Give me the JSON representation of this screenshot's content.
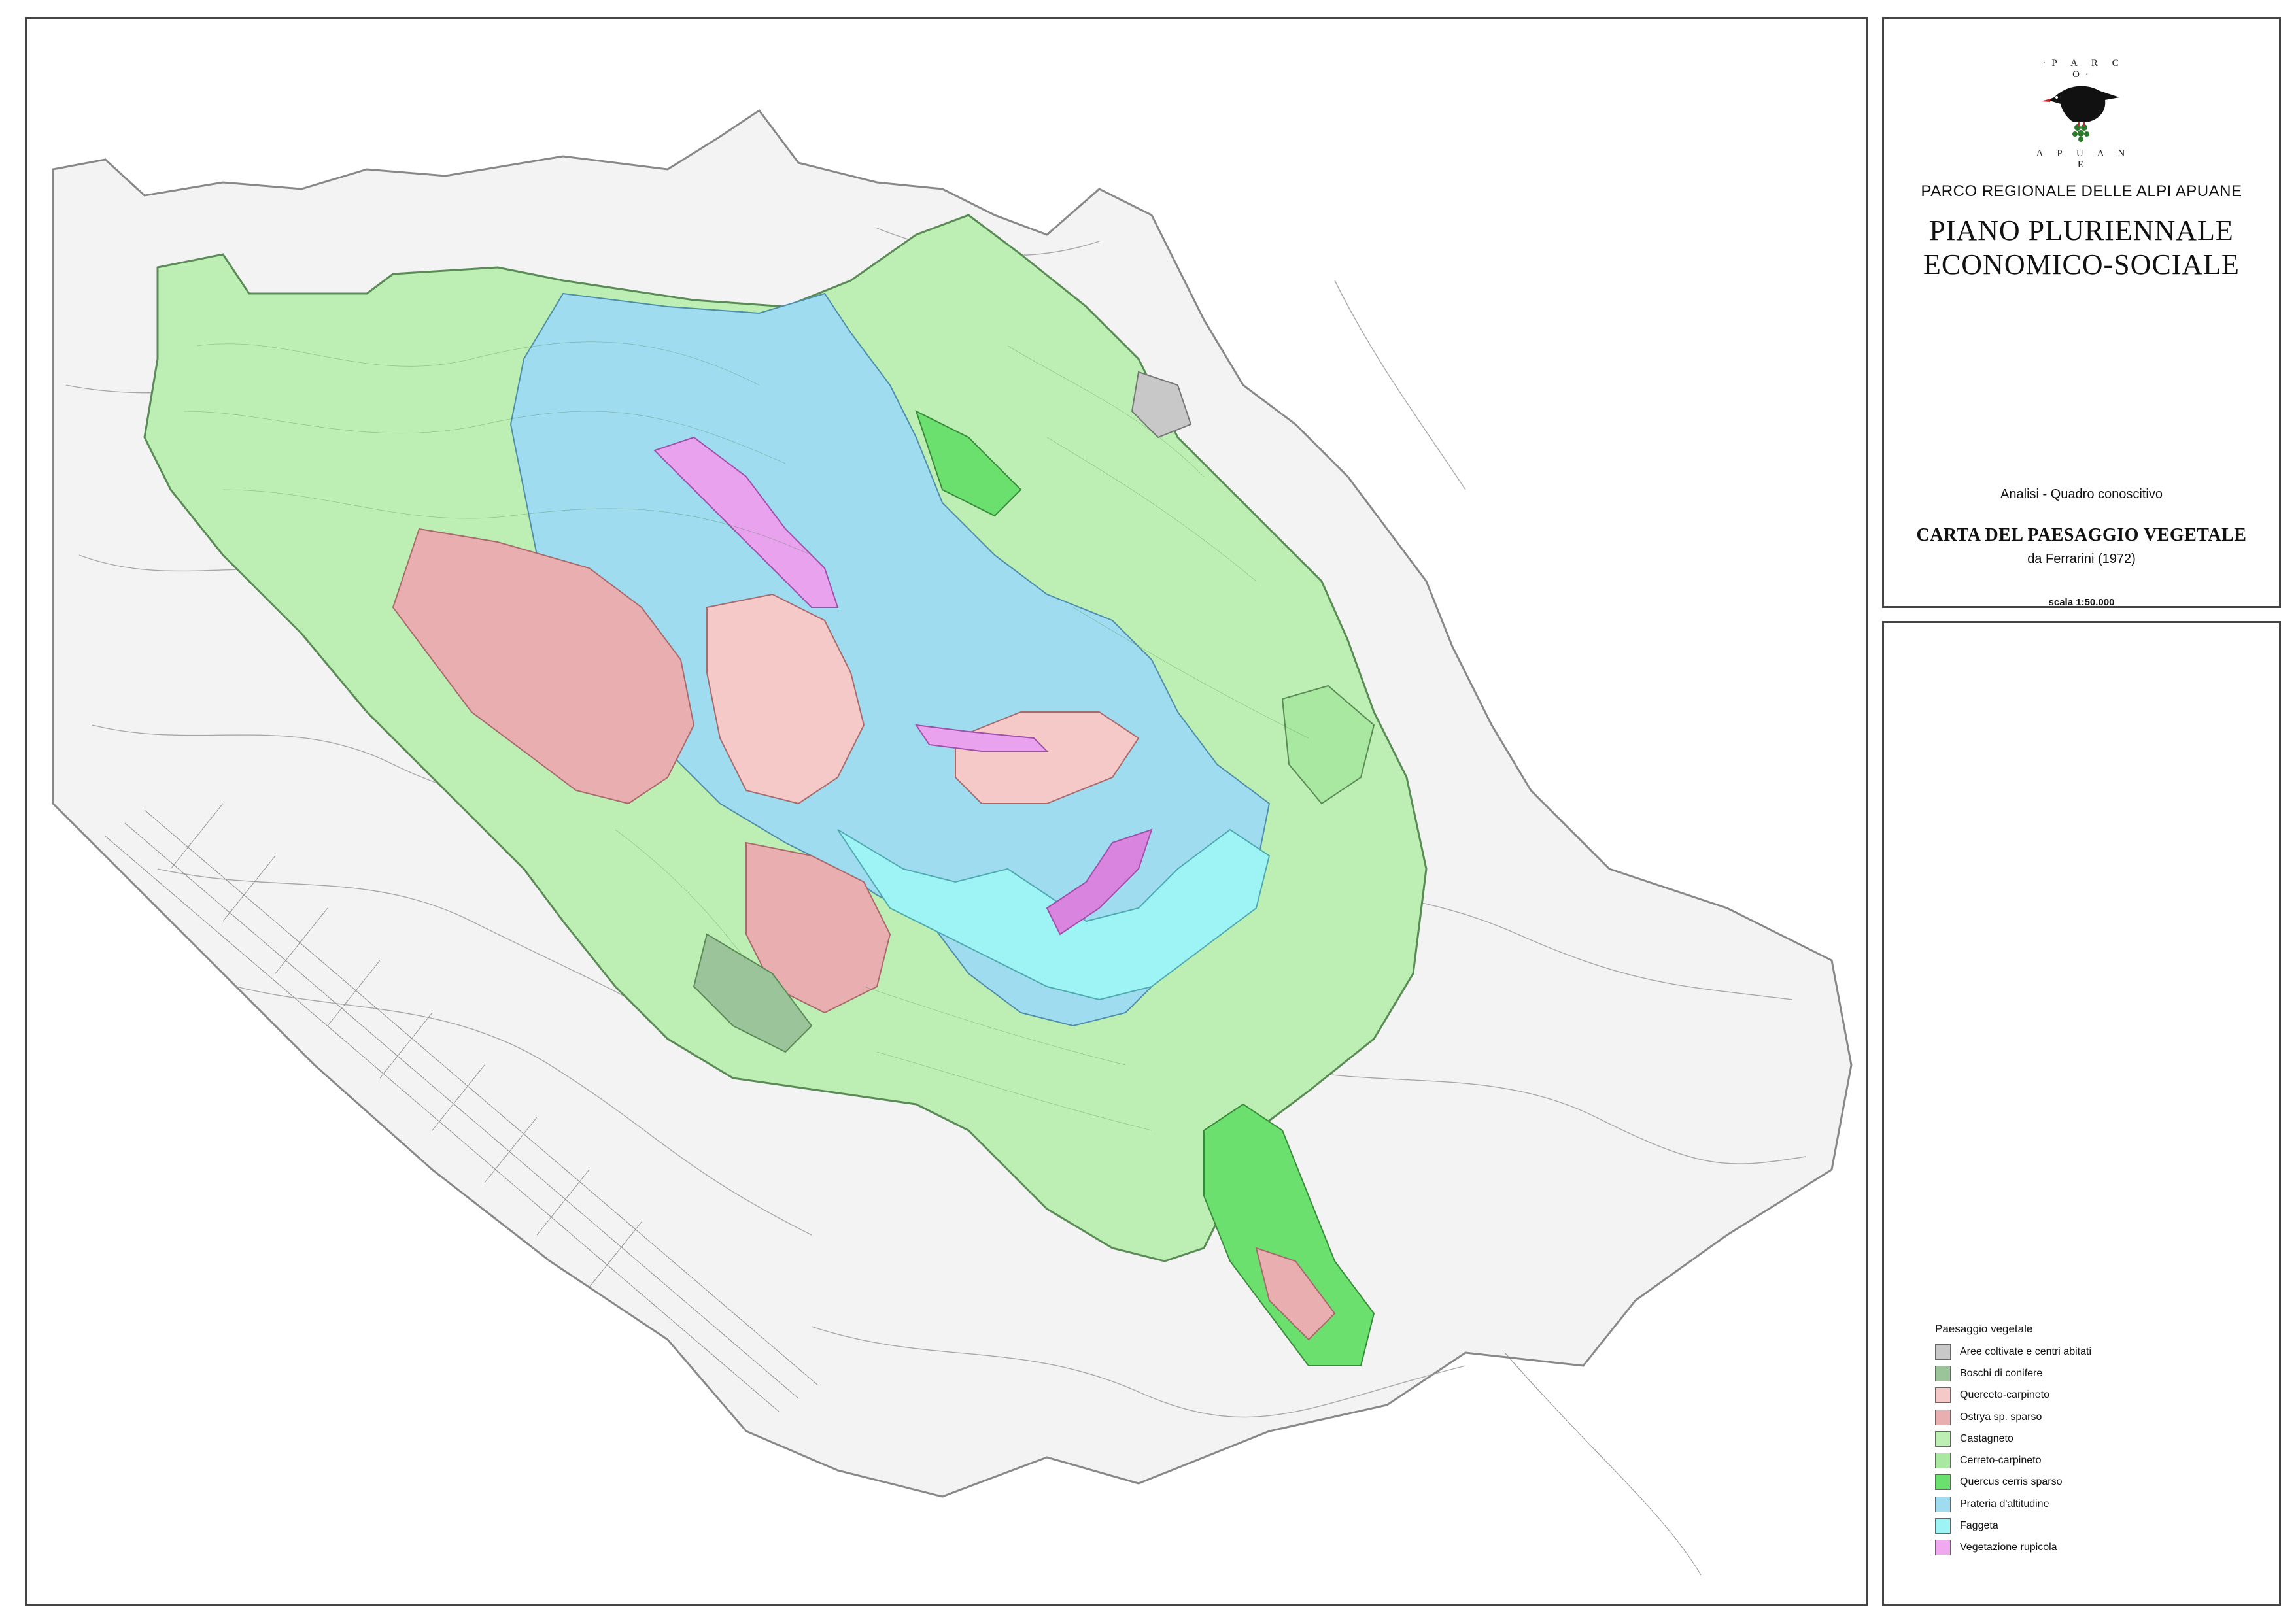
{
  "logo": {
    "top_text": "·P A R C O·",
    "bottom_text": "A P U A N E",
    "icon": "chough-bird-icon"
  },
  "header": {
    "organization": "PARCO REGIONALE DELLE ALPI APUANE",
    "plan_title_line1": "PIANO  PLURIENNALE",
    "plan_title_line2": "ECONOMICO-SOCIALE",
    "analysis": "Analisi - Quadro conoscitivo",
    "map_title": "CARTA DEL PAESAGGIO VEGETALE",
    "map_source": "da Ferrarini (1972)",
    "scale": "scala 1:50.000"
  },
  "legend": {
    "title": "Paesaggio vegetale",
    "items": [
      {
        "label": "Aree coltivate e centri abitati",
        "color": "#c8c8c8"
      },
      {
        "label": "Boschi di conifere",
        "color": "#9cc49a"
      },
      {
        "label": "Querceto-carpineto",
        "color": "#f4c9c7"
      },
      {
        "label": "Ostrya sp. sparso",
        "color": "#e8aeb0"
      },
      {
        "label": "Castagneto",
        "color": "#bdefb4"
      },
      {
        "label": "Cerreto-carpineto",
        "color": "#a8e8a0"
      },
      {
        "label": "Quercus cerris sparso",
        "color": "#6be06e"
      },
      {
        "label": "Prateria d'altitudine",
        "color": "#9fdcf0"
      },
      {
        "label": "Faggeta",
        "color": "#9ef3f5"
      },
      {
        "label": "Vegetazione rupicola",
        "color": "#f0a8f0"
      }
    ]
  }
}
